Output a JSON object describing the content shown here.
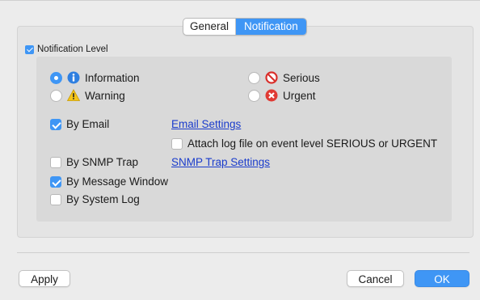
{
  "tabs": {
    "general": "General",
    "notification": "Notification"
  },
  "notification_level": {
    "label": "Notification Level",
    "checked": true
  },
  "levels": {
    "information": {
      "label": "Information",
      "selected": true,
      "icon": "info-icon"
    },
    "warning": {
      "label": "Warning",
      "selected": false,
      "icon": "warning-icon"
    },
    "serious": {
      "label": "Serious",
      "selected": false,
      "icon": "no-entry-icon"
    },
    "urgent": {
      "label": "Urgent",
      "selected": false,
      "icon": "error-x-icon"
    }
  },
  "options": {
    "by_email": {
      "label": "By Email",
      "checked": true
    },
    "email_settings": "Email Settings",
    "attach_log": {
      "label": "Attach log file on event level SERIOUS or URGENT",
      "checked": false
    },
    "by_snmp": {
      "label": "By SNMP Trap",
      "checked": false
    },
    "snmp_settings": "SNMP Trap Settings",
    "by_message_window": {
      "label": "By Message Window",
      "checked": true
    },
    "by_system_log": {
      "label": "By System Log",
      "checked": false
    }
  },
  "buttons": {
    "apply": "Apply",
    "cancel": "Cancel",
    "ok": "OK"
  },
  "colors": {
    "accent": "#3f96f5",
    "link": "#1a3ccc",
    "background": "#ececec"
  }
}
